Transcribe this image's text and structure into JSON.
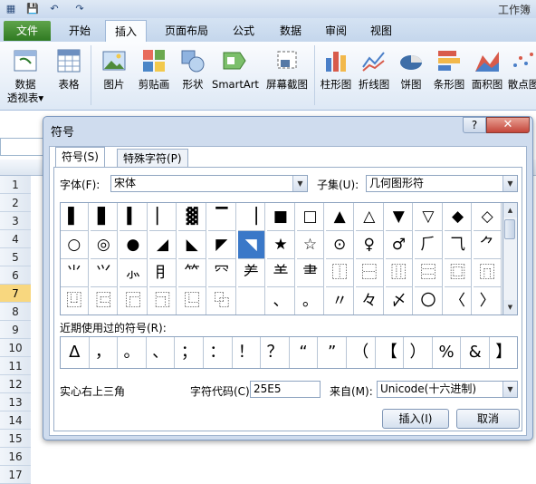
{
  "app": {
    "title": "工作簿"
  },
  "quick_access": {
    "save_icon": "save-icon",
    "undo_icon": "undo-icon",
    "redo_icon": "redo-icon"
  },
  "ribbon_tabs": [
    "文件",
    "开始",
    "插入",
    "页面布局",
    "公式",
    "数据",
    "审阅",
    "视图"
  ],
  "ribbon_buttons": [
    {
      "label": "数据\n透视表▾",
      "icon": "pivot-table-icon"
    },
    {
      "label": "表格",
      "icon": "table-icon"
    },
    {
      "label": "图片",
      "icon": "picture-icon"
    },
    {
      "label": "剪贴画",
      "icon": "clipart-icon"
    },
    {
      "label": "形状",
      "icon": "shapes-icon"
    },
    {
      "label": "SmartArt",
      "icon": "smartart-icon"
    },
    {
      "label": "屏幕截图",
      "icon": "screenshot-icon"
    },
    {
      "label": "柱形图",
      "icon": "column-chart-icon"
    },
    {
      "label": "折线图",
      "icon": "line-chart-icon"
    },
    {
      "label": "饼图",
      "icon": "pie-chart-icon"
    },
    {
      "label": "条形图",
      "icon": "bar-chart-icon"
    },
    {
      "label": "面积图",
      "icon": "area-chart-icon"
    },
    {
      "label": "散点图",
      "icon": "scatter-chart-icon"
    }
  ],
  "rows": [
    "1",
    "2",
    "3",
    "4",
    "5",
    "6",
    "7",
    "8",
    "9",
    "10",
    "11",
    "12",
    "13",
    "14",
    "15",
    "16",
    "17"
  ],
  "selected_row": "7",
  "dialog": {
    "title": "符号",
    "help": "?",
    "close": "✕",
    "tabs": [
      "符号(S)",
      "特殊字符(P)"
    ],
    "font_label": "字体(F):",
    "font_value": "宋体",
    "subset_label": "子集(U):",
    "subset_value": "几何图形符",
    "symbols": [
      [
        "▌",
        "▋",
        "▍",
        "▏",
        "▓",
        "▔",
        "▕",
        "■",
        "□",
        "▲",
        "△",
        "▼",
        "▽",
        "◆",
        "◇"
      ],
      [
        "○",
        "◎",
        "●",
        "◢",
        "◣",
        "◤",
        "◥",
        "★",
        "☆",
        "⊙",
        "♀",
        "♂",
        "⺁",
        "⺄",
        "⺈"
      ],
      [
        "⺌",
        "⺍",
        "⺗",
        "⺝",
        "⺮",
        "⺳",
        "⺶",
        "⺷",
        "⺻",
        "⿰",
        "⿱",
        "⿲",
        "⿳",
        "⿴",
        "⿵"
      ],
      [
        "⿶",
        "⿷",
        "⿸",
        "⿹",
        "⿺",
        "⿻",
        "",
        "、",
        "。",
        "〃",
        "々",
        "〆",
        "〇",
        "〈",
        "〉",
        "《"
      ]
    ],
    "selected_symbol": "◥",
    "recent_label": "近期使用过的符号(R):",
    "recent_symbols": [
      "Δ",
      "，",
      "。",
      "、",
      "；",
      "：",
      "！",
      "？",
      "“",
      "”",
      "（",
      "【",
      "）",
      "%",
      "&",
      "】"
    ],
    "char_name": "实心右上三角",
    "char_code_label": "字符代码(C):",
    "char_code_value": "25E5",
    "from_label": "来自(M):",
    "from_value": "Unicode(十六进制)",
    "insert_button": "插入(I)",
    "cancel_button": "取消"
  }
}
